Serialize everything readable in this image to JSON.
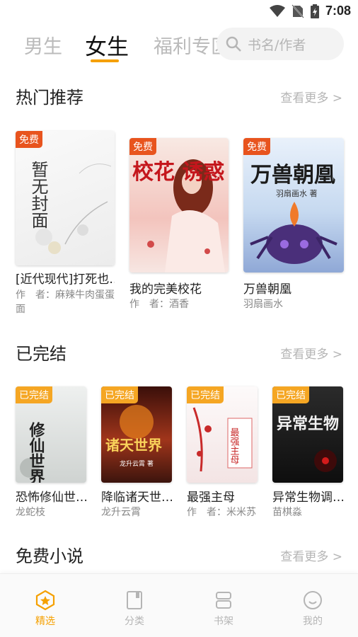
{
  "status_bar": {
    "time": "7:08"
  },
  "tabs": [
    {
      "label": "男生"
    },
    {
      "label": "女生"
    },
    {
      "label": "福利专区"
    }
  ],
  "search": {
    "placeholder": "书名/作者"
  },
  "hot": {
    "title": "热门推荐",
    "more": "查看更多 >",
    "books": [
      {
        "badge": "免费",
        "cover_text": "暂无封面",
        "title": "[近代现代]打死也…",
        "author": "作　者：麻辣牛肉蛋蛋面"
      },
      {
        "badge": "免费",
        "cover_text": "校花 诱惑",
        "title": "我的完美校花",
        "author": "作　者：酒香"
      },
      {
        "badge": "免费",
        "cover_text": "万兽朝凰",
        "cover_sub": "羽扇画水 著",
        "title": "万兽朝凰",
        "author": "羽扇画水"
      }
    ]
  },
  "completed": {
    "title": "已完结",
    "more": "查看更多 >",
    "books": [
      {
        "badge": "已完结",
        "cover_text": "修仙世界",
        "title": "恐怖修仙世…",
        "author": "龙蛇枝"
      },
      {
        "badge": "已完结",
        "cover_text": "诸天世界",
        "cover_sub": "龙升云霄 著",
        "title": "降临诸天世…",
        "author": "龙升云霄"
      },
      {
        "badge": "已完结",
        "cover_text": "最强主母",
        "title": "最强主母",
        "author": "作　者：米米苏"
      },
      {
        "badge": "已完结",
        "cover_text": "异常生物",
        "title": "异常生物调…",
        "author": "苗棋淼"
      }
    ]
  },
  "free": {
    "title": "免费小说",
    "more": "查看更多 >"
  },
  "bottom_nav": [
    {
      "label": "精选",
      "icon": "star-badge-icon"
    },
    {
      "label": "分类",
      "icon": "book-icon"
    },
    {
      "label": "书架",
      "icon": "shelf-icon"
    },
    {
      "label": "我的",
      "icon": "smile-face-icon"
    }
  ],
  "colors": {
    "accent": "#f5a000",
    "free_badge": "#e8541e",
    "done_badge": "#f5a623"
  }
}
